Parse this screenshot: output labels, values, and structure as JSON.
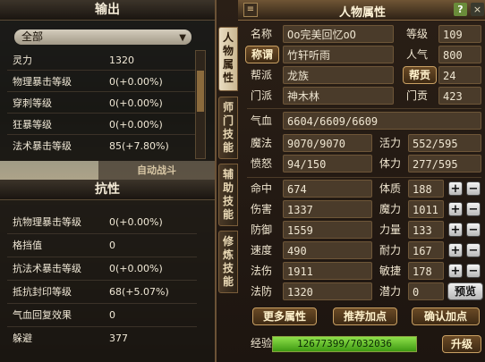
{
  "left": {
    "output": {
      "title": "输出",
      "dropdown_value": "全部",
      "rows": [
        {
          "label": "灵力",
          "value": "1320"
        },
        {
          "label": "物理暴击等级",
          "value": "0(+0.00%)"
        },
        {
          "label": "穿刺等级",
          "value": "0(+0.00%)"
        },
        {
          "label": "狂暴等级",
          "value": "0(+0.00%)"
        },
        {
          "label": "法术暴击等级",
          "value": "85(+7.80%)"
        }
      ]
    },
    "auto_battle": "自动战斗",
    "resistance": {
      "title": "抗性",
      "rows": [
        {
          "label": "抗物理暴击等级",
          "value": "0(+0.00%)"
        },
        {
          "label": "格挡值",
          "value": "0"
        },
        {
          "label": "抗法术暴击等级",
          "value": "0(+0.00%)"
        },
        {
          "label": "抵抗封印等级",
          "value": "68(+5.07%)"
        },
        {
          "label": "气血回复效果",
          "value": "0"
        },
        {
          "label": "躲避",
          "value": "377"
        }
      ]
    }
  },
  "right": {
    "title": "人物属性",
    "help": "?",
    "close": "×",
    "menu_icon": "≡",
    "tabs": [
      "人物属性",
      "师门技能",
      "辅助技能",
      "修炼技能"
    ],
    "name_label": "名称",
    "name_value": "Oo完美回忆oO",
    "level_label": "等级",
    "level_value": "109",
    "title_btn": "称谓",
    "title_value": "竹轩听雨",
    "pop_label": "人气",
    "pop_value": "800",
    "guild_label": "帮派",
    "guild_value": "龙族",
    "contrib_btn": "帮贡",
    "contrib_value": "24",
    "school_label": "门派",
    "school_value": "神木林",
    "school_contrib_label": "门贡",
    "school_contrib_value": "423",
    "hp_label": "气血",
    "hp_value": "6604/6609/6609",
    "stats_left": [
      {
        "label": "魔法",
        "value": "9070/9070"
      },
      {
        "label": "愤怒",
        "value": "94/150"
      },
      {
        "label": "命中",
        "value": "674"
      },
      {
        "label": "伤害",
        "value": "1337"
      },
      {
        "label": "防御",
        "value": "1559"
      },
      {
        "label": "速度",
        "value": "490"
      },
      {
        "label": "法伤",
        "value": "1911"
      },
      {
        "label": "法防",
        "value": "1320"
      }
    ],
    "stats_right_top": [
      {
        "label": "活力",
        "value": "552/595"
      },
      {
        "label": "体力",
        "value": "277/595"
      }
    ],
    "attrs": [
      {
        "label": "体质",
        "value": "188"
      },
      {
        "label": "魔力",
        "value": "1011"
      },
      {
        "label": "力量",
        "value": "133"
      },
      {
        "label": "耐力",
        "value": "167"
      },
      {
        "label": "敏捷",
        "value": "178"
      }
    ],
    "potential_label": "潜力",
    "potential_value": "0",
    "preview_btn": "预览",
    "more_btn": "更多属性",
    "recommend_btn": "推荐加点",
    "confirm_btn": "确认加点",
    "exp_label": "经验",
    "exp_text": "12677399/7032036",
    "exp_fraction": 1.0,
    "levelup_btn": "升级"
  }
}
